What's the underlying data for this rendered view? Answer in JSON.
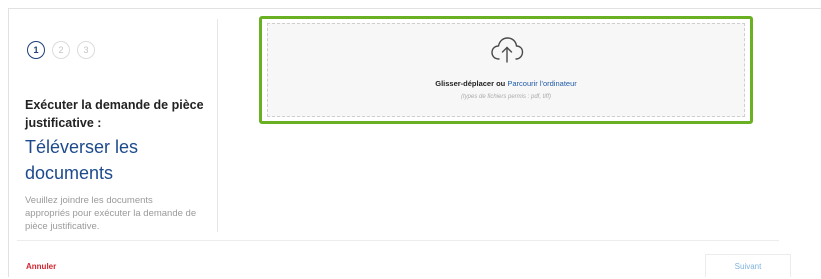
{
  "stepper": {
    "steps": [
      "1",
      "2",
      "3"
    ],
    "active_step": 1
  },
  "left_panel": {
    "title": "Exécuter la demande de pièce justificative :",
    "heading": "Téléverser les documents",
    "description": "Veuillez joindre les documents appropriés pour exécuter la demande de pièce justificative."
  },
  "dropzone": {
    "icon": "cloud-upload-icon",
    "drag_text": "Glisser-déplacer ou",
    "browse_link": "Parcourir l'ordinateur",
    "allowed_types": "(types de fichiers permis : pdf, tiff)"
  },
  "footer": {
    "cancel_label": "Annuler",
    "next_label": "Suivant"
  },
  "colors": {
    "accent_blue": "#1c4a8c",
    "link_blue": "#1e5aa8",
    "highlight_green": "#6ab023",
    "cancel_red": "#d1262f"
  }
}
